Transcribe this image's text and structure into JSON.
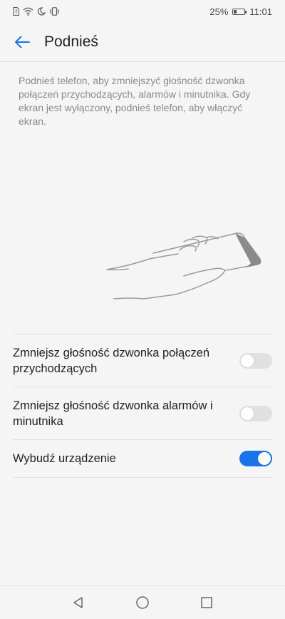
{
  "status_bar": {
    "battery_percent_text": "25%",
    "battery_level": 0.25,
    "time": "11:01",
    "icons": [
      "sim-icon",
      "wifi-icon",
      "moon-icon",
      "vibrate-icon"
    ]
  },
  "header": {
    "title": "Podnieś",
    "back_icon": "arrow-left-icon"
  },
  "description": "Podnieś telefon, aby zmniejszyć głośność dzwonka połączeń przychodzących, alarmów i minutnika. Gdy ekran jest wyłączony, podnieś telefon, aby włączyć ekran.",
  "settings": [
    {
      "label": "Zmniejsz głośność dzwonka połączeń przychodzących",
      "enabled": false
    },
    {
      "label": "Zmniejsz głośność dzwonka alarmów i minutnika",
      "enabled": false
    },
    {
      "label": "Wybudź urządzenie",
      "enabled": true
    }
  ],
  "colors": {
    "accent": "#1a73e8",
    "toggle_off": "#e0e0e0",
    "description_text": "#8a8a8a"
  },
  "nav_bar": {
    "icons": [
      "back-triangle-icon",
      "home-circle-icon",
      "recents-square-icon"
    ]
  }
}
